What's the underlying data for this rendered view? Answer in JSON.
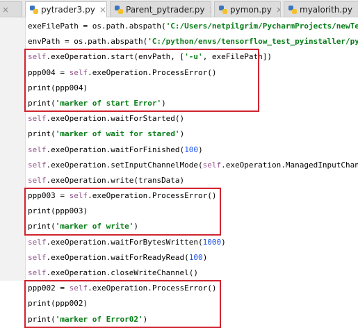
{
  "tabs": [
    {
      "label": "",
      "active": false
    },
    {
      "label": "pytrader3.py",
      "active": true
    },
    {
      "label": "Parent_pytrader.py",
      "active": false
    },
    {
      "label": "pymon.py",
      "active": false
    },
    {
      "label": "myalorith.py",
      "active": false
    }
  ],
  "code_lines": [
    [
      [
        "plain",
        "exeFilePath = os.path.abspath("
      ],
      [
        "str",
        "'C:/Users/netpilgrim/PycharmProjects/newTe"
      ]
    ],
    [
      [
        "plain",
        "envPath = os.path.abspath("
      ],
      [
        "str",
        "'C:/python/envs/tensorflow_test_pyinstaller/py"
      ]
    ],
    [
      [
        "self",
        "self"
      ],
      [
        "plain",
        ".exeOperation.start(envPath, ["
      ],
      [
        "str",
        "'-u'"
      ],
      [
        "plain",
        ", exeFilePath])"
      ]
    ],
    [
      [
        "plain",
        "ppp004 = "
      ],
      [
        "self",
        "self"
      ],
      [
        "plain",
        ".exeOperation.ProcessError()"
      ]
    ],
    [
      [
        "plain",
        "print(ppp004)"
      ]
    ],
    [
      [
        "plain",
        "print("
      ],
      [
        "str",
        "'marker of start Error'"
      ],
      [
        "plain",
        ")"
      ]
    ],
    [
      [
        "self",
        "self"
      ],
      [
        "plain",
        ".exeOperation.waitForStarted()"
      ]
    ],
    [
      [
        "plain",
        "print("
      ],
      [
        "str",
        "'marker of wait for stared'"
      ],
      [
        "plain",
        ")"
      ]
    ],
    [
      [
        "self",
        "self"
      ],
      [
        "plain",
        ".exeOperation.waitForFinished("
      ],
      [
        "num",
        "100"
      ],
      [
        "plain",
        ")"
      ]
    ],
    [
      [
        "self",
        "self"
      ],
      [
        "plain",
        ".exeOperation.setInputChannelMode("
      ],
      [
        "self",
        "self"
      ],
      [
        "plain",
        ".exeOperation.ManagedInputChannel)"
      ]
    ],
    [
      [
        "self",
        "self"
      ],
      [
        "plain",
        ".exeOperation.write(transData)"
      ]
    ],
    [
      [
        "plain",
        "ppp003 = "
      ],
      [
        "self",
        "self"
      ],
      [
        "plain",
        ".exeOperation.ProcessError()"
      ]
    ],
    [
      [
        "plain",
        "print(ppp003)"
      ]
    ],
    [
      [
        "plain",
        "print("
      ],
      [
        "str",
        "'marker of write'"
      ],
      [
        "plain",
        ")"
      ]
    ],
    [
      [
        "self",
        "self"
      ],
      [
        "plain",
        ".exeOperation.waitForBytesWritten("
      ],
      [
        "num",
        "1000"
      ],
      [
        "plain",
        ")"
      ]
    ],
    [
      [
        "self",
        "self"
      ],
      [
        "plain",
        ".exeOperation.waitForReadyRead("
      ],
      [
        "num",
        "100"
      ],
      [
        "plain",
        ")"
      ]
    ],
    [
      [
        "self",
        "self"
      ],
      [
        "plain",
        ".exeOperation.closeWriteChannel()"
      ]
    ],
    [
      [
        "plain",
        "ppp002 = "
      ],
      [
        "self",
        "self"
      ],
      [
        "plain",
        ".exeOperation.ProcessError()"
      ]
    ],
    [
      [
        "plain",
        "print(ppp002)"
      ]
    ],
    [
      [
        "plain",
        "print("
      ],
      [
        "str",
        "'marker of Error02'"
      ],
      [
        "plain",
        ")"
      ]
    ]
  ],
  "highlight_boxes": [
    {
      "first_line": 3,
      "last_line": 6
    },
    {
      "first_line": 12,
      "last_line": 14
    },
    {
      "first_line": 18,
      "last_line": 20
    }
  ],
  "colors": {
    "highlight": "#d0232f",
    "self": "#94558d",
    "string": "#067d17",
    "number": "#1750eb"
  }
}
